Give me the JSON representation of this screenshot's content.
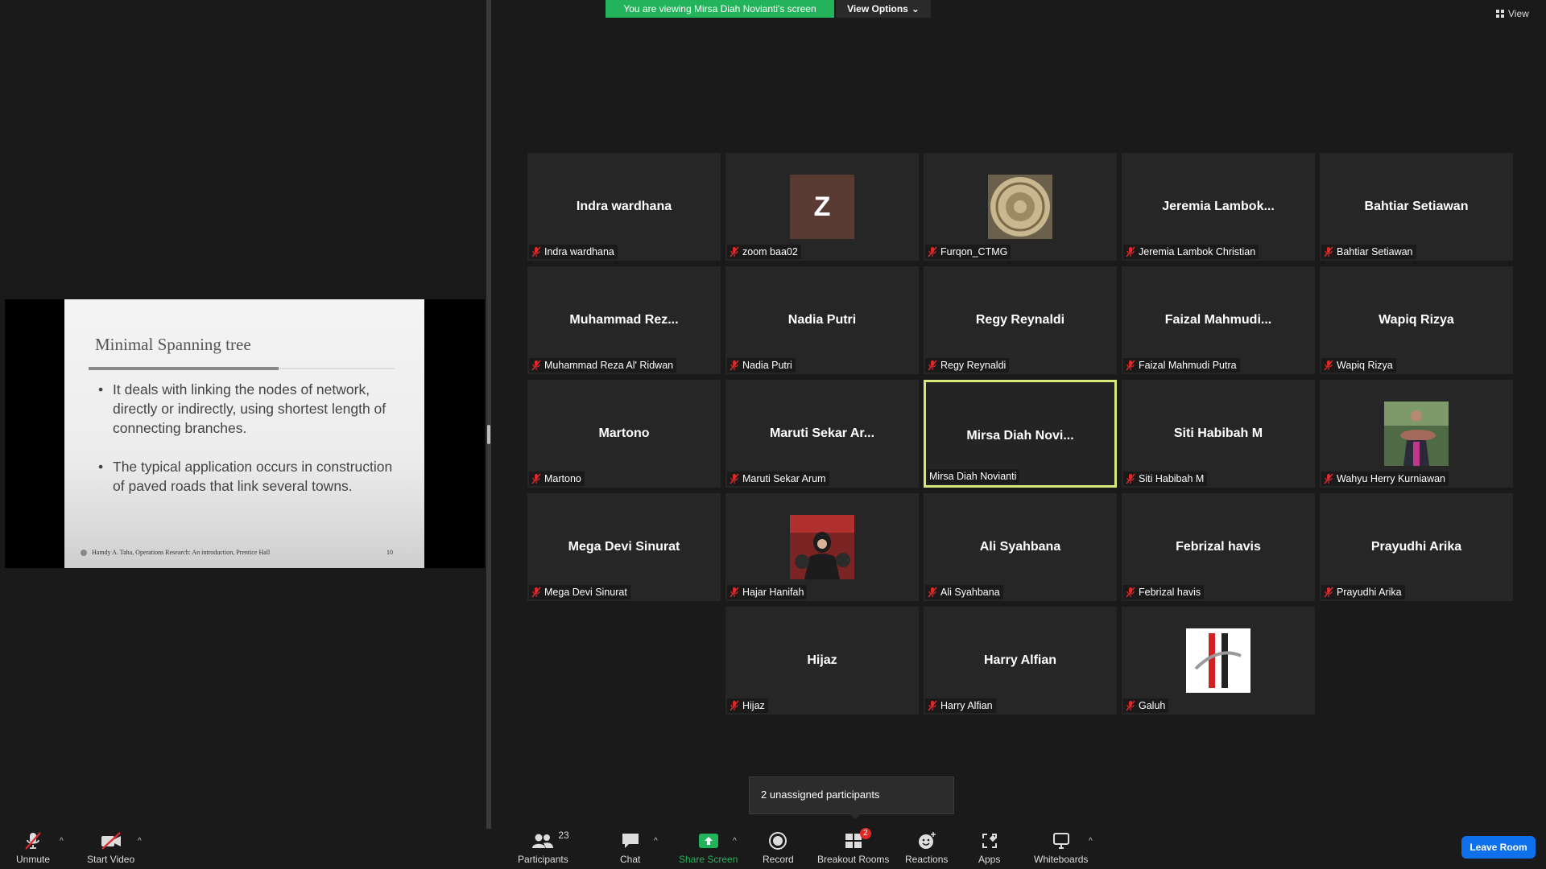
{
  "banner": {
    "text": "You are viewing Mirsa Diah Novianti's screen",
    "color": "#23b35b"
  },
  "view_options": {
    "label": "View Options"
  },
  "view_button": {
    "label": "View"
  },
  "slide": {
    "title": "Minimal Spanning tree",
    "bullets": [
      "It deals with linking the nodes of network, directly or indirectly, using shortest length of connecting branches.",
      "The typical application occurs in construction of paved roads that link several towns."
    ],
    "footer": "Hamdy A. Taha, Operations Research: An introduction, Prentice Hall",
    "page": "10"
  },
  "tiles": [
    {
      "display": "Indra wardhana",
      "tag": "Indra wardhana",
      "muted": true
    },
    {
      "display": "",
      "tag": "zoom baa02",
      "muted": true,
      "avatar_letter": "Z"
    },
    {
      "display": "",
      "tag": "Furqon_CTMG",
      "muted": true
    },
    {
      "display": "Jeremia  Lambok...",
      "tag": "Jeremia Lambok Christian",
      "muted": true
    },
    {
      "display": "Bahtiar Setiawan",
      "tag": "Bahtiar Setiawan",
      "muted": true
    },
    {
      "display": "Muhammad  Rez...",
      "tag": "Muhammad Reza Al' Ridwan",
      "muted": true
    },
    {
      "display": "Nadia Putri",
      "tag": "Nadia Putri",
      "muted": true
    },
    {
      "display": "Regy Reynaldi",
      "tag": "Regy Reynaldi",
      "muted": true
    },
    {
      "display": "Faizal  Mahmudi...",
      "tag": "Faizal Mahmudi Putra",
      "muted": true
    },
    {
      "display": "Wapiq Rizya",
      "tag": "Wapiq Rizya",
      "muted": true
    },
    {
      "display": "Martono",
      "tag": "Martono",
      "muted": true
    },
    {
      "display": "Maruti  Sekar  Ar...",
      "tag": "Maruti Sekar Arum",
      "muted": true
    },
    {
      "display": "Mirsa  Diah  Novi...",
      "tag": "Mirsa Diah Novianti",
      "muted": false,
      "active": true
    },
    {
      "display": "Siti Habibah M",
      "tag": "Siti Habibah M",
      "muted": true
    },
    {
      "display": "",
      "tag": "Wahyu Herry Kurniawan",
      "muted": true
    },
    {
      "display": "Mega Devi Sinurat",
      "tag": "Mega Devi Sinurat",
      "muted": true
    },
    {
      "display": "",
      "tag": "Hajar Hanifah",
      "muted": true
    },
    {
      "display": "Ali Syahbana",
      "tag": "Ali Syahbana",
      "muted": true
    },
    {
      "display": "Febrizal havis",
      "tag": "Febrizal havis",
      "muted": true
    },
    {
      "display": "Prayudhi Arika",
      "tag": "Prayudhi Arika",
      "muted": true
    },
    {
      "display": "Hijaz",
      "tag": "Hijaz",
      "muted": true
    },
    {
      "display": "Harry Alfian",
      "tag": "Harry Alfian",
      "muted": true
    },
    {
      "display": "",
      "tag": "Galuh",
      "muted": true
    }
  ],
  "popup": {
    "text": "2 unassigned participants"
  },
  "toolbar": {
    "unmute": "Unmute",
    "start_video": "Start Video",
    "participants": "Participants",
    "participants_count": "23",
    "chat": "Chat",
    "share_screen": "Share Screen",
    "record": "Record",
    "breakout_rooms": "Breakout Rooms",
    "breakout_badge": "2",
    "reactions": "Reactions",
    "apps": "Apps",
    "whiteboards": "Whiteboards",
    "leave": "Leave Room"
  },
  "colors": {
    "accent_green": "#23b35b",
    "leave_blue": "#0e71eb",
    "mute_red": "#e02828",
    "active_border": "#d8e87a"
  }
}
